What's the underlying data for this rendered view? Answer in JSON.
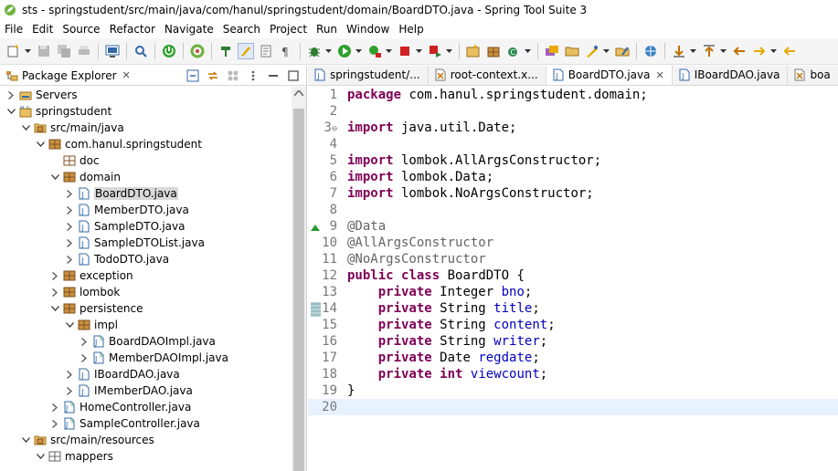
{
  "window": {
    "title": "sts - springstudent/src/main/java/com/hanul/springstudent/domain/BoardDTO.java - Spring Tool Suite 3"
  },
  "menu": [
    "File",
    "Edit",
    "Source",
    "Refactor",
    "Navigate",
    "Search",
    "Project",
    "Run",
    "Window",
    "Help"
  ],
  "package_explorer": {
    "tab_label": "Package Explorer",
    "tree": [
      {
        "label": "Servers",
        "depth": 0,
        "icon": "server-folder-icon",
        "twisty": "collapsed"
      },
      {
        "label": "springstudent",
        "depth": 0,
        "icon": "maven-project-icon",
        "twisty": "expanded"
      },
      {
        "label": "src/main/java",
        "depth": 1,
        "icon": "source-folder-icon",
        "twisty": "expanded"
      },
      {
        "label": "com.hanul.springstudent",
        "depth": 2,
        "icon": "package-icon",
        "twisty": "expanded"
      },
      {
        "label": "doc",
        "depth": 3,
        "icon": "empty-package-icon",
        "twisty": "none"
      },
      {
        "label": "domain",
        "depth": 3,
        "icon": "package-icon",
        "twisty": "expanded"
      },
      {
        "label": "BoardDTO.java",
        "depth": 4,
        "icon": "java-file-icon",
        "twisty": "collapsed",
        "selected": true
      },
      {
        "label": "MemberDTO.java",
        "depth": 4,
        "icon": "java-file-icon",
        "twisty": "collapsed"
      },
      {
        "label": "SampleDTO.java",
        "depth": 4,
        "icon": "java-file-icon",
        "twisty": "collapsed"
      },
      {
        "label": "SampleDTOList.java",
        "depth": 4,
        "icon": "java-file-icon",
        "twisty": "collapsed"
      },
      {
        "label": "TodoDTO.java",
        "depth": 4,
        "icon": "java-file-icon",
        "twisty": "collapsed"
      },
      {
        "label": "exception",
        "depth": 3,
        "icon": "package-icon",
        "twisty": "collapsed"
      },
      {
        "label": "lombok",
        "depth": 3,
        "icon": "package-icon",
        "twisty": "collapsed"
      },
      {
        "label": "persistence",
        "depth": 3,
        "icon": "package-icon",
        "twisty": "expanded"
      },
      {
        "label": "impl",
        "depth": 4,
        "icon": "package-icon",
        "twisty": "expanded"
      },
      {
        "label": "BoardDAOImpl.java",
        "depth": 5,
        "icon": "spring-java-file-icon",
        "twisty": "collapsed"
      },
      {
        "label": "MemberDAOImpl.java",
        "depth": 5,
        "icon": "spring-java-file-icon",
        "twisty": "collapsed"
      },
      {
        "label": "IBoardDAO.java",
        "depth": 4,
        "icon": "java-file-icon",
        "twisty": "collapsed"
      },
      {
        "label": "IMemberDAO.java",
        "depth": 4,
        "icon": "java-file-icon",
        "twisty": "collapsed"
      },
      {
        "label": "HomeController.java",
        "depth": 3,
        "icon": "spring-java-file-icon",
        "twisty": "collapsed"
      },
      {
        "label": "SampleController.java",
        "depth": 3,
        "icon": "spring-java-file-icon",
        "twisty": "collapsed"
      },
      {
        "label": "src/main/resources",
        "depth": 1,
        "icon": "source-folder-icon",
        "twisty": "expanded"
      },
      {
        "label": "mappers",
        "depth": 2,
        "icon": "folder-package-icon",
        "twisty": "expanded"
      }
    ]
  },
  "editor": {
    "tabs": [
      {
        "label": "springstudent/...",
        "icon": "java-file-icon",
        "active": false,
        "closable": false
      },
      {
        "label": "root-context.x...",
        "icon": "xml-file-icon",
        "active": false,
        "closable": false
      },
      {
        "label": "BoardDTO.java",
        "icon": "java-file-icon",
        "active": true,
        "closable": true
      },
      {
        "label": "IBoardDAO.java",
        "icon": "java-file-icon",
        "active": false,
        "closable": false
      },
      {
        "label": "boa",
        "icon": "xml-file-icon",
        "active": false,
        "closable": false
      }
    ],
    "lines": [
      {
        "n": "1",
        "tokens": [
          [
            "kw",
            "package"
          ],
          [
            "t",
            " com.hanul.springstudent.domain;"
          ]
        ]
      },
      {
        "n": "2",
        "tokens": []
      },
      {
        "n": "3",
        "fold": "⊖",
        "tokens": [
          [
            "kw",
            "import"
          ],
          [
            "t",
            " java.util.Date;"
          ]
        ]
      },
      {
        "n": "4",
        "tokens": []
      },
      {
        "n": "5",
        "tokens": [
          [
            "kw",
            "import"
          ],
          [
            "t",
            " lombok.AllArgsConstructor;"
          ]
        ]
      },
      {
        "n": "6",
        "tokens": [
          [
            "kw",
            "import"
          ],
          [
            "t",
            " lombok.Data;"
          ]
        ]
      },
      {
        "n": "7",
        "tokens": [
          [
            "kw",
            "import"
          ],
          [
            "t",
            " lombok.NoArgsConstructor;"
          ]
        ]
      },
      {
        "n": "8",
        "tokens": []
      },
      {
        "n": "9",
        "marker": "override",
        "tokens": [
          [
            "ann",
            "@Data"
          ]
        ]
      },
      {
        "n": "10",
        "tokens": [
          [
            "ann",
            "@AllArgsConstructor"
          ]
        ]
      },
      {
        "n": "11",
        "tokens": [
          [
            "ann",
            "@NoArgsConstructor"
          ]
        ]
      },
      {
        "n": "12",
        "tokens": [
          [
            "kw",
            "public"
          ],
          [
            "t",
            " "
          ],
          [
            "kw",
            "class"
          ],
          [
            "t",
            " BoardDTO {"
          ]
        ]
      },
      {
        "n": "13",
        "tokens": [
          [
            "t",
            "    "
          ],
          [
            "kw",
            "private"
          ],
          [
            "t",
            " Integer "
          ],
          [
            "fld",
            "bno"
          ],
          [
            "t",
            ";"
          ]
        ]
      },
      {
        "n": "14",
        "marker": "change",
        "tokens": [
          [
            "t",
            "    "
          ],
          [
            "kw",
            "private"
          ],
          [
            "t",
            " String "
          ],
          [
            "fld",
            "title"
          ],
          [
            "t",
            ";"
          ]
        ]
      },
      {
        "n": "15",
        "tokens": [
          [
            "t",
            "    "
          ],
          [
            "kw",
            "private"
          ],
          [
            "t",
            " String "
          ],
          [
            "fld",
            "content"
          ],
          [
            "t",
            ";"
          ]
        ]
      },
      {
        "n": "16",
        "tokens": [
          [
            "t",
            "    "
          ],
          [
            "kw",
            "private"
          ],
          [
            "t",
            " String "
          ],
          [
            "fld",
            "writer"
          ],
          [
            "t",
            ";"
          ]
        ]
      },
      {
        "n": "17",
        "tokens": [
          [
            "t",
            "    "
          ],
          [
            "kw",
            "private"
          ],
          [
            "t",
            " Date "
          ],
          [
            "fld",
            "regdate"
          ],
          [
            "t",
            ";"
          ]
        ]
      },
      {
        "n": "18",
        "tokens": [
          [
            "t",
            "    "
          ],
          [
            "kw",
            "private"
          ],
          [
            "t",
            " "
          ],
          [
            "kw",
            "int"
          ],
          [
            "t",
            " "
          ],
          [
            "fld",
            "viewcount"
          ],
          [
            "t",
            ";"
          ]
        ]
      },
      {
        "n": "19",
        "tokens": [
          [
            "t",
            "}"
          ]
        ]
      },
      {
        "n": "20",
        "current": true,
        "tokens": []
      }
    ]
  },
  "colors": {
    "keyword": "#7f0055",
    "annotation": "#646464",
    "field": "#0000c0",
    "current_line": "#e8f2fe",
    "selection": "#d9d9d9"
  }
}
